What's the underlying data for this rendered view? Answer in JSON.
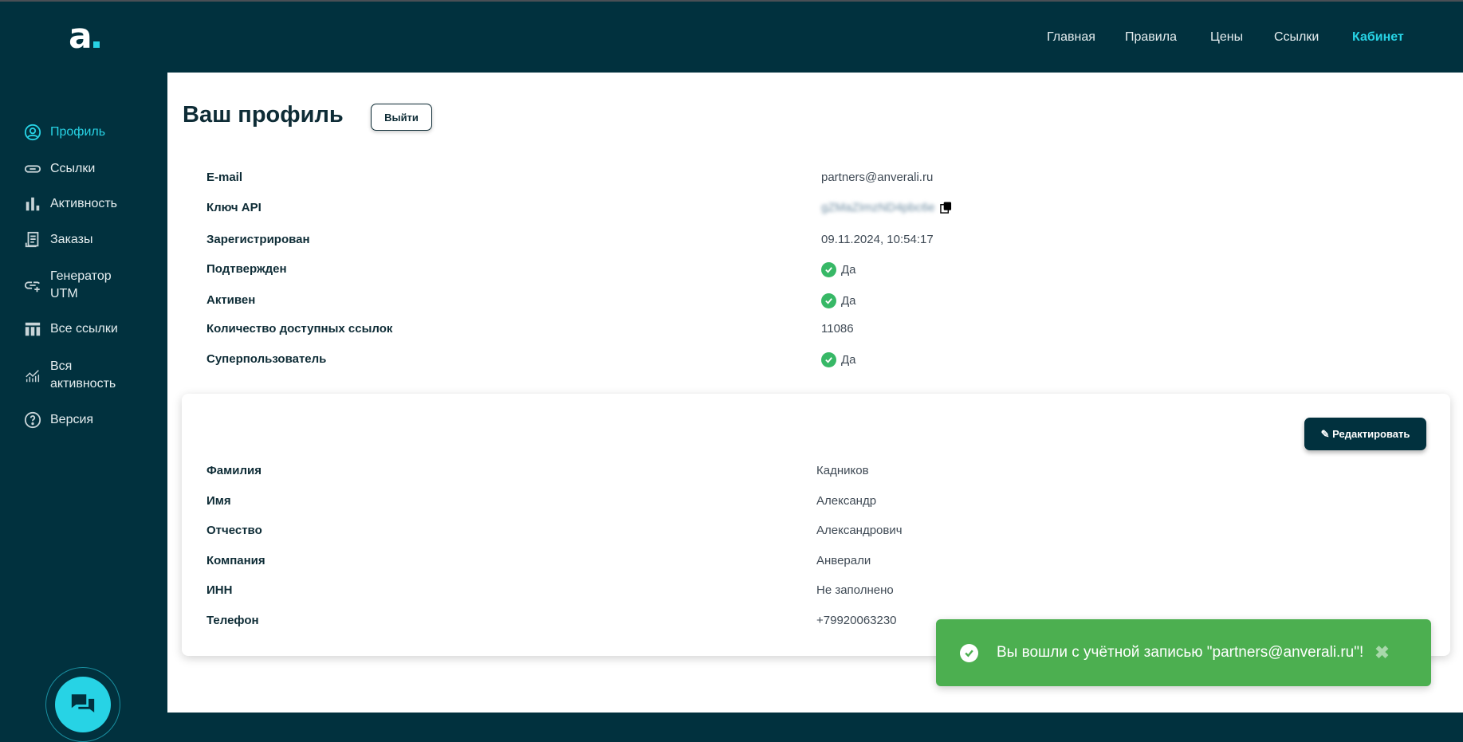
{
  "brand": {
    "logo": "a",
    "accent": "#27d3e5",
    "bg": "#01313e"
  },
  "nav": [
    {
      "label": "Главная"
    },
    {
      "label": "Правила"
    },
    {
      "label": "Цены"
    },
    {
      "label": "Ссылки"
    },
    {
      "label": "Кабинет",
      "active": true
    }
  ],
  "sidebar": {
    "items": [
      {
        "label": "Профиль",
        "icon": "user-circle-icon",
        "active": true
      },
      {
        "label": "Ссылки",
        "icon": "link-icon"
      },
      {
        "label": "Активность",
        "icon": "bar-chart-icon"
      },
      {
        "label": "Заказы",
        "icon": "receipt-icon"
      },
      {
        "label": "Генератор UTM",
        "icon": "link-add-icon"
      },
      {
        "label": "Все ссылки",
        "icon": "table-icon"
      },
      {
        "label": "Вся активность",
        "icon": "trend-chart-icon"
      },
      {
        "label": "Версия",
        "icon": "question-circle-icon"
      }
    ]
  },
  "profile": {
    "title": "Ваш профиль",
    "logout_label": "Выйти",
    "rows": [
      {
        "label": "E-mail",
        "value": "partners@anverali.ru"
      },
      {
        "label": "Ключ API",
        "value": "gZMaZImzND4pbc6e"
      },
      {
        "label": "Зарегистрирован",
        "value": "09.11.2024, 10:54:17"
      },
      {
        "label": "Подтвержден",
        "value": "Да"
      },
      {
        "label": "Активен",
        "value": "Да"
      },
      {
        "label": "Количество доступных ссылок",
        "value": "11086"
      },
      {
        "label": "Суперпользователь",
        "value": "Да"
      }
    ]
  },
  "details": {
    "edit_label": "Редактировать",
    "rows": [
      {
        "label": "Фамилия",
        "value": "Кадников"
      },
      {
        "label": "Имя",
        "value": "Александр"
      },
      {
        "label": "Отчество",
        "value": "Александрович"
      },
      {
        "label": "Компания",
        "value": "Анверали"
      },
      {
        "label": "ИНН",
        "value": "Не заполнено"
      },
      {
        "label": "Телефон",
        "value": "+79920063230"
      }
    ]
  },
  "toast": {
    "message": "Вы вошли с учётной записью \"partners@anverali.ru\"!",
    "close": "✖",
    "color": "#4caf50"
  }
}
